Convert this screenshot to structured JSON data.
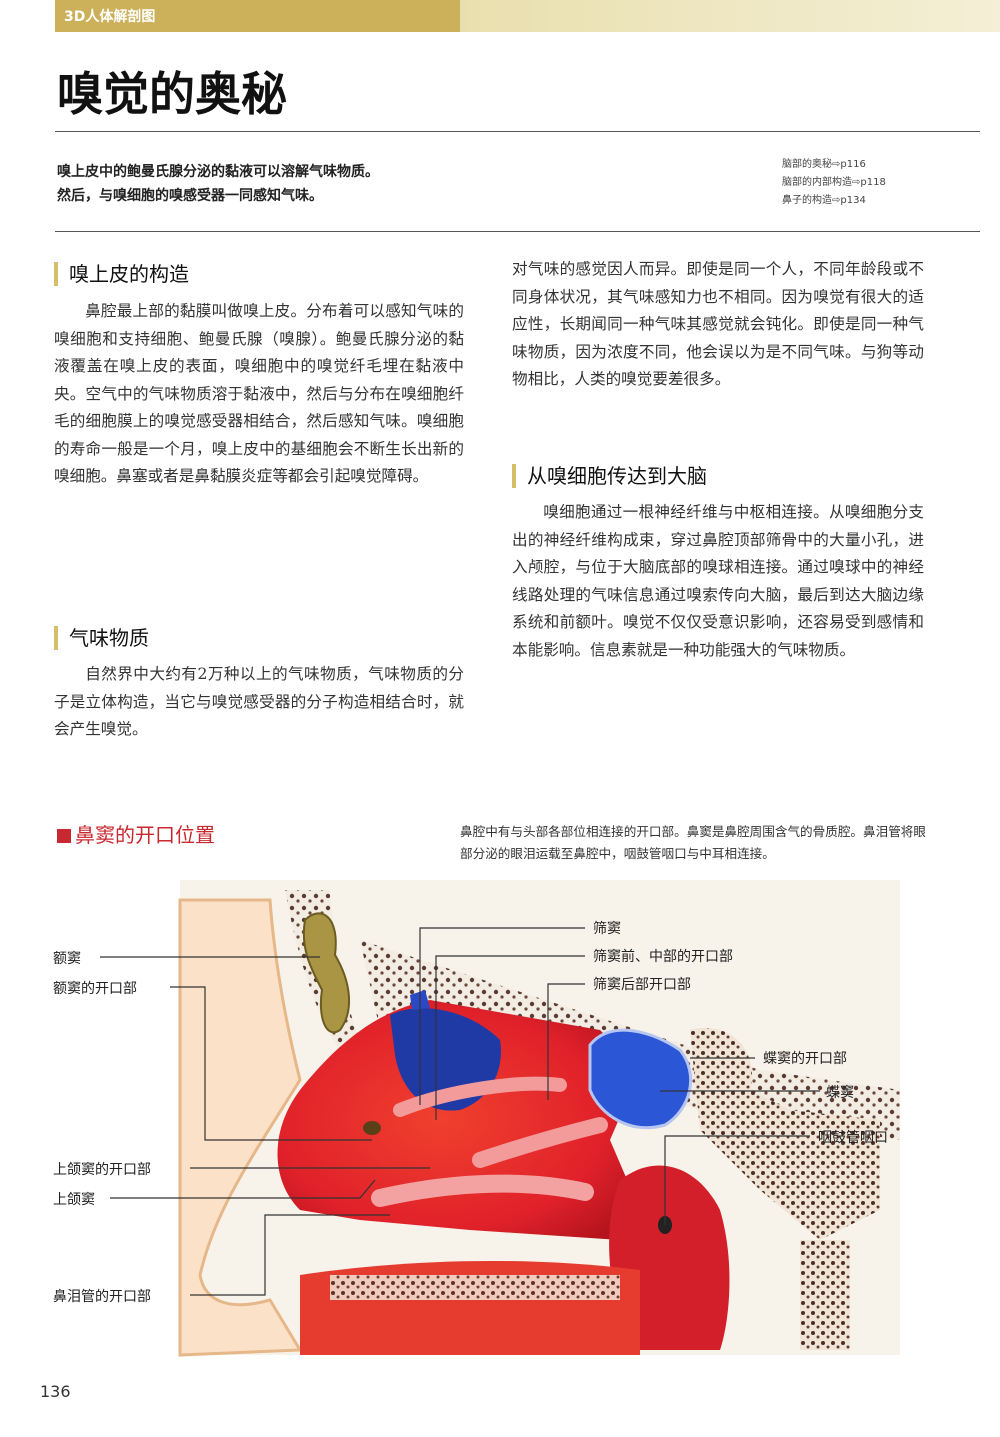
{
  "header": {
    "series": "3D人体解剖图",
    "title": "嗅觉的奥秘"
  },
  "summary": {
    "line1": "嗅上皮中的鲍曼氏腺分泌的黏液可以溶解气味物质。",
    "line2": "然后，与嗅细胞的嗅感受器一同感知气味。"
  },
  "refs": [
    "脑部的奥秘⇨p116",
    "脑部的内部构造⇨p118",
    "鼻子的构造⇨p134"
  ],
  "sections": {
    "s1_title": "嗅上皮的构造",
    "s1_text": "鼻腔最上部的黏膜叫做嗅上皮。分布着可以感知气味的嗅细胞和支持细胞、鲍曼氏腺（嗅腺）。鲍曼氏腺分泌的黏液覆盖在嗅上皮的表面，嗅细胞中的嗅觉纤毛埋在黏液中央。空气中的气味物质溶于黏液中，然后与分布在嗅细胞纤毛的细胞膜上的嗅觉感受器相结合，然后感知气味。嗅细胞的寿命一般是一个月，嗅上皮中的基细胞会不断生长出新的嗅细胞。鼻塞或者是鼻黏膜炎症等都会引起嗅觉障碍。",
    "s2_title": "气味物质",
    "s2_text": "自然界中大约有2万种以上的气味物质，气味物质的分子是立体构造，当它与嗅觉感受器的分子构造相结合时，就会产生嗅觉。",
    "s2_cont": "对气味的感觉因人而异。即使是同一个人，不同年龄段或不同身体状况，其气味感知力也不相同。因为嗅觉有很大的适应性，长期闻同一种气味其感觉就会钝化。即使是同一种气味物质，因为浓度不同，他会误以为是不同气味。与狗等动物相比，人类的嗅觉要差很多。",
    "s3_title": "从嗅细胞传达到大脑",
    "s3_text": "嗅细胞通过一根神经纤维与中枢相连接。从嗅细胞分支出的神经纤维构成束，穿过鼻腔顶部筛骨中的大量小孔，进入颅腔，与位于大脑底部的嗅球相连接。通过嗅球中的神经线路处理的气味信息通过嗅索传向大脑，最后到达大脑边缘系统和前额叶。嗅觉不仅仅受意识影响，还容易受到感情和本能影响。信息素就是一种功能强大的气味物质。"
  },
  "figure": {
    "title": "鼻窦的开口位置",
    "caption": "鼻腔中有与头部各部位相连接的开口部。鼻窦是鼻腔周围含气的骨质腔。鼻泪管将眼部分泌的眼泪运载至鼻腔中，咽鼓管咽口与中耳相连接。",
    "labels": {
      "frontal_sinus": "额窦",
      "frontal_opening": "额窦的开口部",
      "maxillary_opening": "上颌窦的开口部",
      "maxillary_sinus": "上颌窦",
      "nasolacrimal_opening": "鼻泪管的开口部",
      "ethmoid_sinus": "筛窦",
      "ethmoid_ant_mid": "筛窦前、中部的开口部",
      "ethmoid_post": "筛窦后部开口部",
      "sphenoid_opening": "蝶窦的开口部",
      "sphenoid_sinus": "蝶窦",
      "eustachian": "咽鼓管咽口"
    }
  },
  "page_number": "136"
}
